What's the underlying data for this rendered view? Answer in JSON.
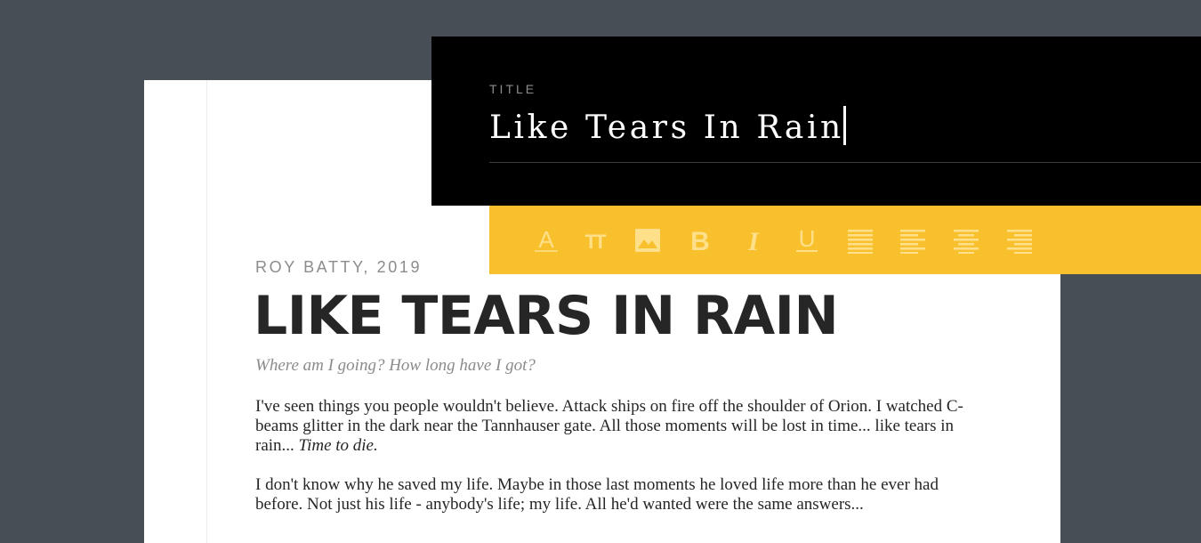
{
  "editor": {
    "title_label": "TITLE",
    "title_value": "Like Tears In Rain"
  },
  "toolbar": {
    "icons": [
      "font-color-icon",
      "font-size-icon",
      "image-icon",
      "bold-icon",
      "italic-icon",
      "underline-icon",
      "align-justify-icon",
      "align-left-icon",
      "align-center-icon",
      "align-right-icon"
    ],
    "bold_glyph": "B",
    "italic_glyph": "I",
    "underline_glyph": "U",
    "font_glyph": "A",
    "font_size_glyph": "TT",
    "icon_color": "#ffe08a",
    "background": "#f9c02d"
  },
  "article": {
    "byline": "ROY BATTY, 2019",
    "headline": "LIKE TEARS IN RAIN",
    "subtitle": "Where am I going? How long have I got?",
    "paragraph_1": "I've seen things you people wouldn't believe. Attack ships on fire off the shoulder of Orion. I watched C-beams glitter in the dark near the Tannhauser gate. All those moments will be lost in time... like tears in rain... ",
    "paragraph_1_emphasis": "Time to die.",
    "paragraph_2": "I don't know why he saved my life. Maybe in those last moments he loved life more than he ever had before. Not just his life - anybody's life; my life. All he'd wanted were the same answers..."
  },
  "colors": {
    "background": "#474e55",
    "panel": "#000000",
    "accent": "#f9c02d",
    "page": "#ffffff"
  }
}
